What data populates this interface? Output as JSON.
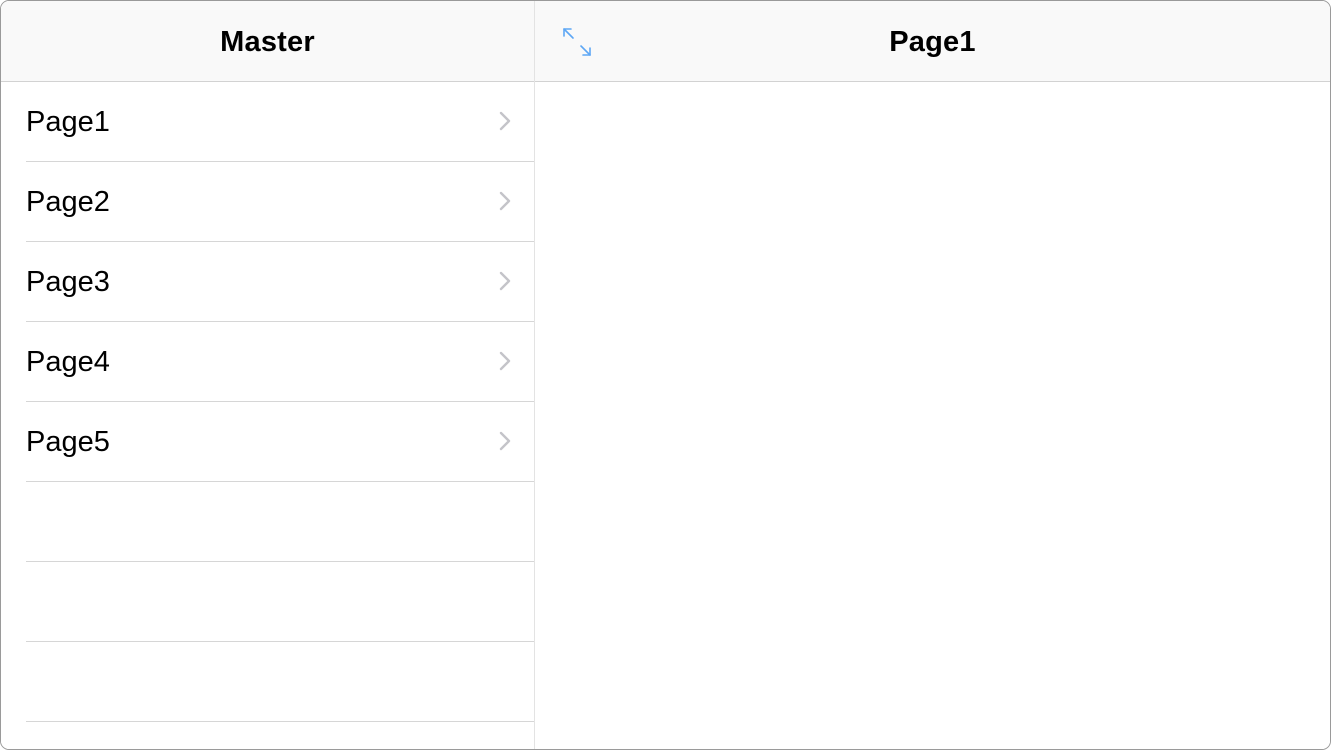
{
  "master": {
    "title": "Master",
    "items": [
      {
        "label": "Page1"
      },
      {
        "label": "Page2"
      },
      {
        "label": "Page3"
      },
      {
        "label": "Page4"
      },
      {
        "label": "Page5"
      },
      {
        "label": ""
      },
      {
        "label": ""
      },
      {
        "label": ""
      }
    ]
  },
  "detail": {
    "title": "Page1",
    "expand_icon": "expand-arrows-icon"
  },
  "colors": {
    "accent": "#5ea7f5",
    "chevron": "#c4c4c9",
    "separator": "#d6d6d6",
    "navbar_bg": "#f9f9f9"
  }
}
